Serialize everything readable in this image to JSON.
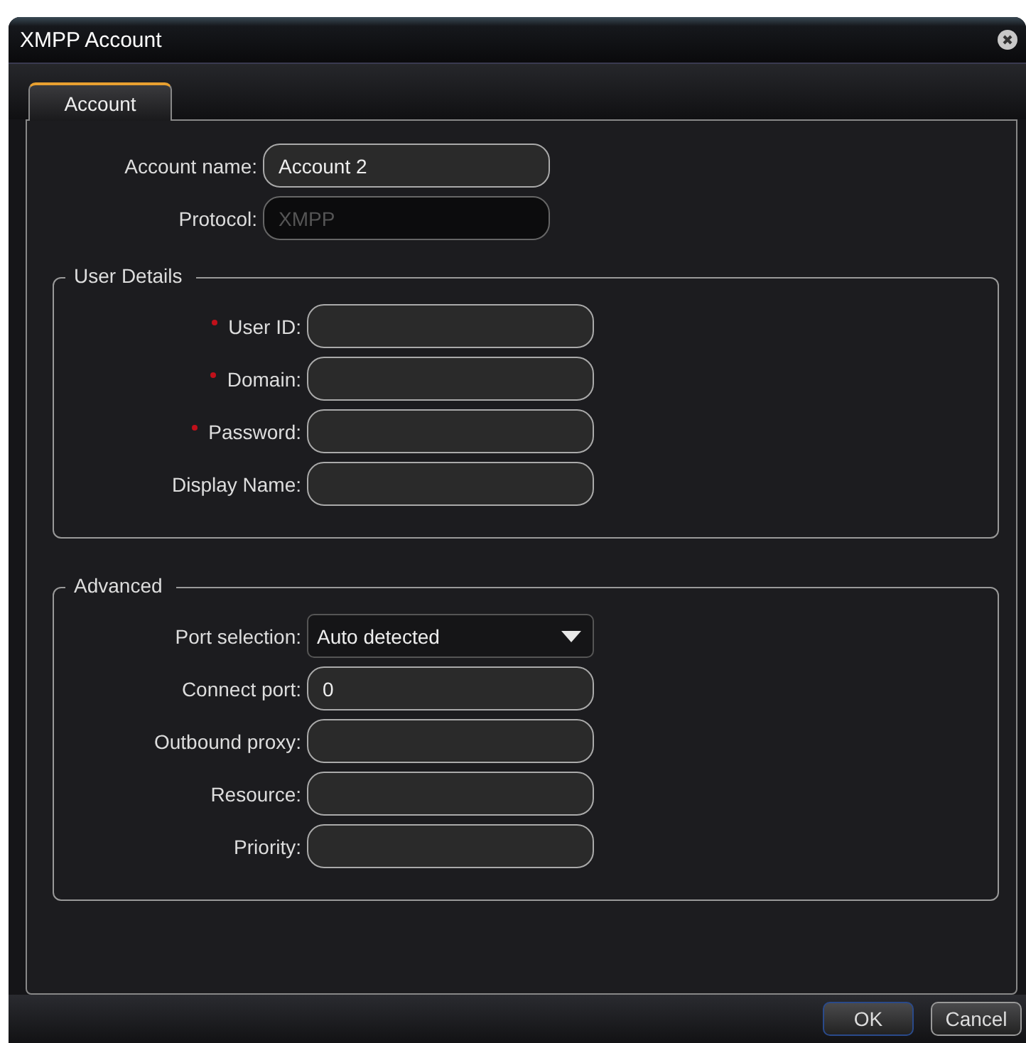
{
  "window": {
    "title": "XMPP Account"
  },
  "tabs": [
    {
      "label": "Account",
      "selected": true
    }
  ],
  "account_fields": [
    {
      "label": "Account name:",
      "kind": "text",
      "value": "Account 2",
      "disabled": false
    },
    {
      "label": "Protocol:",
      "kind": "text",
      "value": "XMPP",
      "disabled": true
    }
  ],
  "groups": [
    {
      "title": "User Details",
      "fields": [
        {
          "label": "User ID:",
          "kind": "text",
          "required": true
        },
        {
          "label": "Domain:",
          "kind": "text",
          "required": true
        },
        {
          "label": "Password:",
          "kind": "text",
          "required": true
        },
        {
          "label": "Display Name:",
          "kind": "text",
          "required": false
        }
      ]
    },
    {
      "title": "Advanced",
      "fields": [
        {
          "label": "Port selection:",
          "kind": "dropdown",
          "value": "Auto detected"
        },
        {
          "label": "Connect port:",
          "kind": "text",
          "value": "0"
        },
        {
          "label": "Outbound proxy:",
          "kind": "text"
        },
        {
          "label": "Resource:",
          "kind": "text"
        },
        {
          "label": "Priority:",
          "kind": "text"
        }
      ]
    }
  ],
  "buttons": [
    {
      "label": "OK",
      "default": true
    },
    {
      "label": "Cancel",
      "default": false
    }
  ]
}
